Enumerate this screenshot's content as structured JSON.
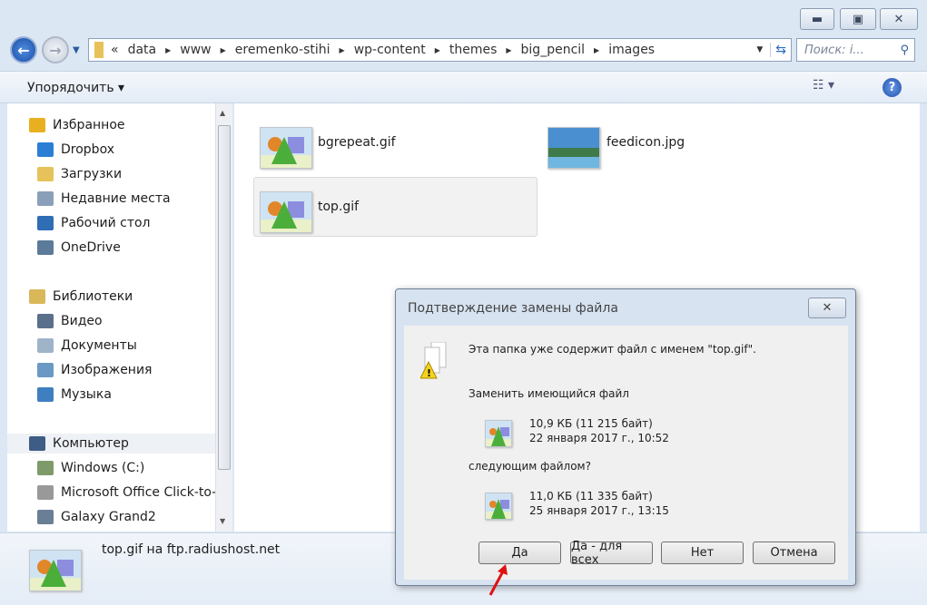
{
  "window": {
    "minimize_icon": "minimize-icon",
    "maximize_icon": "maximize-icon",
    "close_icon": "close-icon"
  },
  "address": {
    "overflow": "«",
    "crumbs": [
      "data",
      "www",
      "eremenko-stihi",
      "wp-content",
      "themes",
      "big_pencil",
      "images"
    ],
    "search_placeholder": "Поиск: i..."
  },
  "toolbar": {
    "organize": "Упорядочить ▾"
  },
  "sidebar": {
    "items": [
      {
        "label": "Избранное",
        "icon": "star-icon",
        "color": "#e8b020"
      },
      {
        "label": "Dropbox",
        "icon": "dropbox-icon",
        "color": "#2a7fd4"
      },
      {
        "label": "Загрузки",
        "icon": "downloads-folder-icon",
        "color": "#e6c35a"
      },
      {
        "label": "Недавние места",
        "icon": "recent-places-icon",
        "color": "#8aa0b8"
      },
      {
        "label": "Рабочий стол",
        "icon": "desktop-icon",
        "color": "#2f6db5"
      },
      {
        "label": "OneDrive",
        "icon": "onedrive-icon",
        "color": "#5c7a99"
      },
      {
        "label": "Библиотеки",
        "icon": "libraries-icon",
        "color": "#d9b85a"
      },
      {
        "label": "Видео",
        "icon": "video-icon",
        "color": "#5a6f8a"
      },
      {
        "label": "Документы",
        "icon": "documents-icon",
        "color": "#9fb3c9"
      },
      {
        "label": "Изображения",
        "icon": "pictures-icon",
        "color": "#6a9ac4"
      },
      {
        "label": "Музыка",
        "icon": "music-icon",
        "color": "#3f7fc0"
      },
      {
        "label": "Компьютер",
        "icon": "computer-icon",
        "color": "#3d5d85"
      },
      {
        "label": "Windows (C:)",
        "icon": "drive-icon",
        "color": "#7f9a6a"
      },
      {
        "label": "Microsoft Office Click-to-",
        "icon": "drive-icon",
        "color": "#999999"
      },
      {
        "label": "Galaxy Grand2",
        "icon": "phone-icon",
        "color": "#6a7f95"
      }
    ]
  },
  "files": [
    {
      "name": "bgrepeat.gif",
      "icon": "gif-image-icon"
    },
    {
      "name": "feedicon.jpg",
      "icon": "jpg-image-icon"
    },
    {
      "name": "top.gif",
      "icon": "gif-image-icon",
      "selected": true
    }
  ],
  "details": {
    "text": "top.gif на ftp.radiushost.net"
  },
  "dialog": {
    "title": "Подтверждение замены файла",
    "message": "Эта папка уже содержит файл с именем \"top.gif\".",
    "replace_label": "Заменить имеющийся файл",
    "existing": {
      "size": "10,9 КБ (11 215 байт)",
      "date": "22 января 2017 г., 10:52"
    },
    "with_label": "следующим файлом?",
    "new": {
      "size": "11,0 КБ (11 335 байт)",
      "date": "25 января 2017 г., 13:15"
    },
    "buttons": {
      "yes": "Да",
      "yes_all": "Да - для всех",
      "no": "Нет",
      "cancel": "Отмена"
    }
  }
}
